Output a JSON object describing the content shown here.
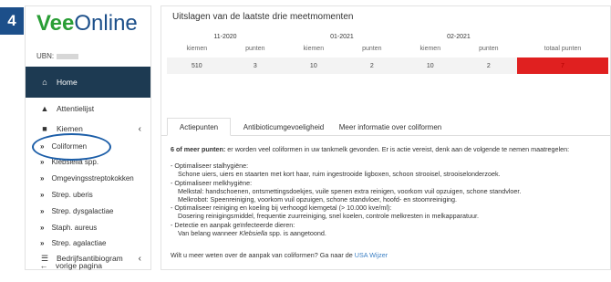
{
  "step_badge": "4",
  "brand": {
    "part1": "Vee",
    "part2": "Online"
  },
  "ubn_label": "UBN:",
  "sidebar": {
    "home": "Home",
    "attentielijst": "Attentielijst",
    "kiemen": "Kiemen",
    "sub_items": [
      "Coliformen",
      "Klebsiella spp.",
      "Omgevingsstreptokokken",
      "Strep. uberis",
      "Strep. dysgalactiae",
      "Staph. aureus",
      "Strep. agalactiae"
    ],
    "bedrijfsantibiogram": "Bedrijfsantibiogram",
    "back": "vorige pagina"
  },
  "main": {
    "title": "Uitslagen van de laatste drie meetmomenten",
    "dates": [
      "11-2020",
      "01-2021",
      "02-2021"
    ],
    "headers": [
      "kiemen",
      "punten",
      "kiemen",
      "punten",
      "kiemen",
      "punten",
      "totaal punten"
    ],
    "values": [
      "510",
      "3",
      "10",
      "2",
      "10",
      "2",
      "7"
    ],
    "total_color": "#e02020"
  },
  "tabs": [
    "Actiepunten",
    "Antibioticumgevoeligheid",
    "Meer informatie over coliformen"
  ],
  "content": {
    "intro_bold": "6 of meer punten:",
    "intro_rest": " er worden veel coliformen in uw tankmelk gevonden. Er is actie vereist, denk aan de volgende te nemen maatregelen:",
    "lines": [
      "- Optimaliseer stalhygiëne:",
      "Schone uiers, uiers en staarten met kort haar, ruim ingestrooide ligboxen, schoon strooisel, strooiselonderzoek.",
      "- Optimaliseer melkhygiëne:",
      "Melkstal: handschoenen, ontsmettingsdoekjes, vuile spenen extra reinigen, voorkom vuil opzuigen, schone standvloer.",
      "Melkrobot: Speenreiniging, voorkom vuil opzuigen, schone standvloer, hoofd- en stoomreiniging.",
      "- Optimaliseer reiniging en koeling bij verhoogd kiemgetal (> 10.000 kve/ml):",
      "Dosering reinigingsmiddel, frequentie zuurreiniging, snel koelen, controle melkresten in melkapparatuur.",
      "- Detectie en aanpak geïnfecteerde dieren:"
    ],
    "last_prefix": "Van belang wanneer ",
    "last_italic": "Klebsiella",
    "last_suffix": " spp. is aangetoond.",
    "footer_text": "Wilt u meer weten over de aanpak van coliformen? Ga naar de ",
    "footer_link": "USA Wijzer"
  }
}
